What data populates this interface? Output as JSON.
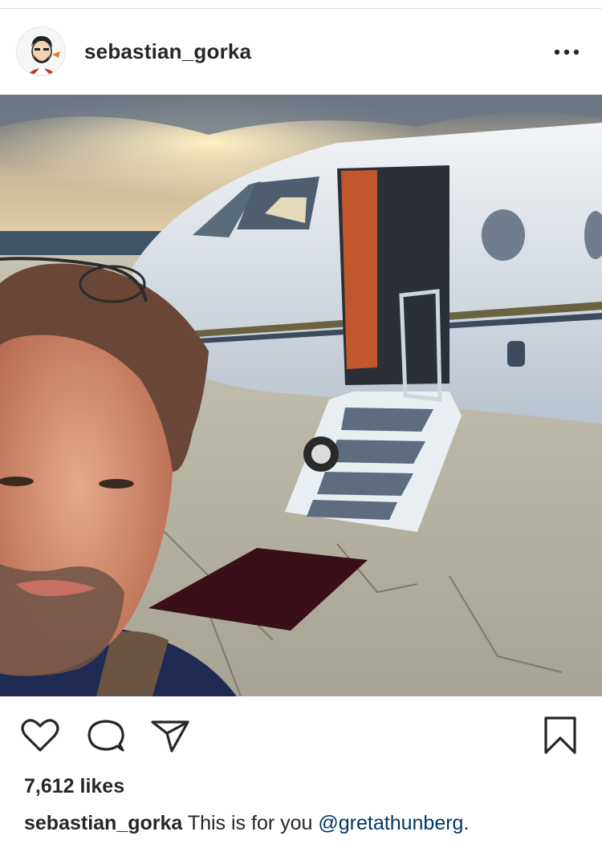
{
  "post": {
    "username": "sebastian_gorka",
    "likes": "7,612 likes",
    "caption": {
      "username": "sebastian_gorka",
      "text": "This is for you",
      "mention": "@gretathunberg",
      "end": "."
    }
  },
  "icons": {
    "more": "more-options-icon",
    "like": "heart-icon",
    "comment": "comment-icon",
    "share": "paper-plane-icon",
    "save": "bookmark-icon"
  },
  "colors": {
    "text": "#262626",
    "mention": "#003569",
    "divider": "#dbdbdb"
  }
}
